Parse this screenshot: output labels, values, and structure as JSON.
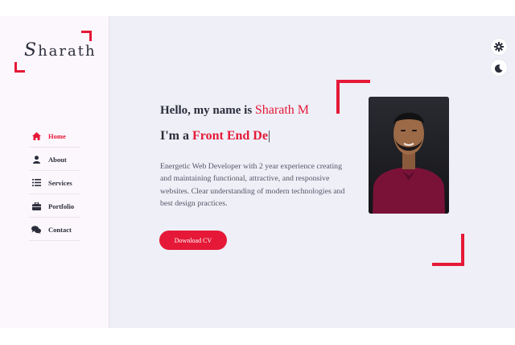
{
  "logo": {
    "first_letter": "S",
    "rest": "harath"
  },
  "nav": [
    {
      "label": "Home",
      "icon": "home-icon",
      "active": true
    },
    {
      "label": "About",
      "icon": "user-icon",
      "active": false
    },
    {
      "label": "Services",
      "icon": "list-icon",
      "active": false
    },
    {
      "label": "Portfolio",
      "icon": "briefcase-icon",
      "active": false
    },
    {
      "label": "Contact",
      "icon": "chat-icon",
      "active": false
    }
  ],
  "hero": {
    "greeting": "Hello, my name is ",
    "name": "Sharath M",
    "role_prefix": "I'm a ",
    "role_typed": "Front End De",
    "cursor": "|",
    "description": "Energetic Web Developer with 2 year experience creating and maintaining functional, attractive, and responsive websites. Clear understanding of modern technologies and best design practices.",
    "cv_button": "Download CV"
  },
  "toolbar": {
    "settings_icon": "gear-icon",
    "theme_icon": "moon-icon"
  },
  "colors": {
    "accent": "#e51937",
    "text": "#2b2d3a",
    "background": "#eeeff7",
    "sidebar": "#fcf7fc"
  }
}
